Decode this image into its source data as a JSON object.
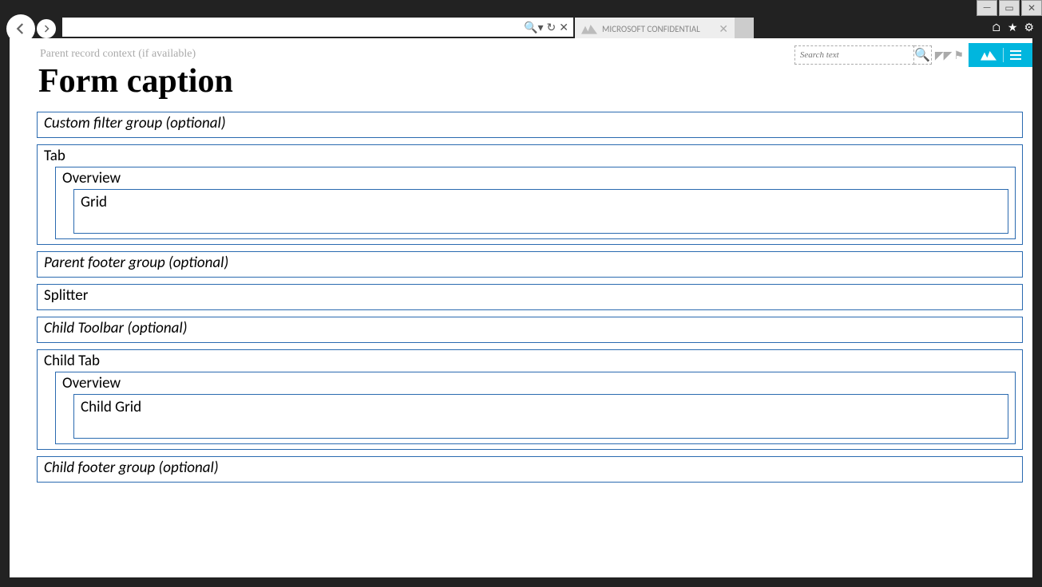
{
  "browser": {
    "tab_label": "MICROSOFT CONFIDENTIAL",
    "url_search_dropdown": "",
    "top_icons": {
      "home": "⌂",
      "star": "★",
      "gear": "⚙"
    }
  },
  "content_header": {
    "breadcrumb": "Parent record context (if available)",
    "form_caption": "Form caption",
    "search_placeholder": "Search text"
  },
  "groups": {
    "custom_filter": "Custom filter group (optional)",
    "tab": "Tab",
    "overview": "Overview",
    "grid": "Grid",
    "parent_footer": "Parent footer group (optional)",
    "splitter": "Splitter",
    "child_toolbar": "Child Toolbar (optional)",
    "child_tab": "Child Tab",
    "child_overview": "Overview",
    "child_grid": "Child Grid",
    "child_footer": "Child footer group (optional)"
  }
}
